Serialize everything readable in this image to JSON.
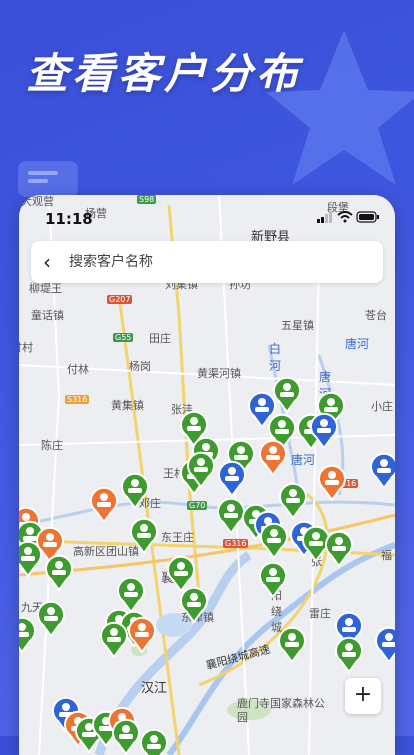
{
  "promo": {
    "title": "查看客户分布"
  },
  "statusbar": {
    "time": "11:18"
  },
  "search": {
    "placeholder": "搜索客户名称"
  },
  "map": {
    "places": [
      "大观营",
      "杨营",
      "段堡",
      "新野县",
      "柳堤王",
      "刘集镇",
      "孙坊",
      "苍台",
      "童话镇",
      "田庄",
      "五星镇",
      "付村",
      "付林",
      "杨岗",
      "黄渠河镇",
      "小庄",
      "黄集镇",
      "张洼",
      "陈庄",
      "王村",
      "邓庄",
      "高新区团山镇",
      "东王庄",
      "襄",
      "襄阳绕城",
      "张",
      "福",
      "九天",
      "东津镇",
      "雷庄",
      "汉江",
      "鹿门寺国家森林公园",
      "襄阳绕城高速",
      "山"
    ],
    "rivers": [
      "白河",
      "唐河",
      "唐河",
      "唐河"
    ],
    "roads": [
      "S98",
      "G207",
      "G55",
      "S316",
      "G70",
      "G316",
      "316"
    ]
  },
  "colors": {
    "green": "#3e9b2e",
    "orange": "#ef7433",
    "blue": "#2f63d8"
  },
  "icons": {
    "back": "chevron-left-icon",
    "zoom_in": "plus-icon",
    "marker": "customer-marker-icon"
  },
  "zoom": {
    "in_label": "+"
  }
}
